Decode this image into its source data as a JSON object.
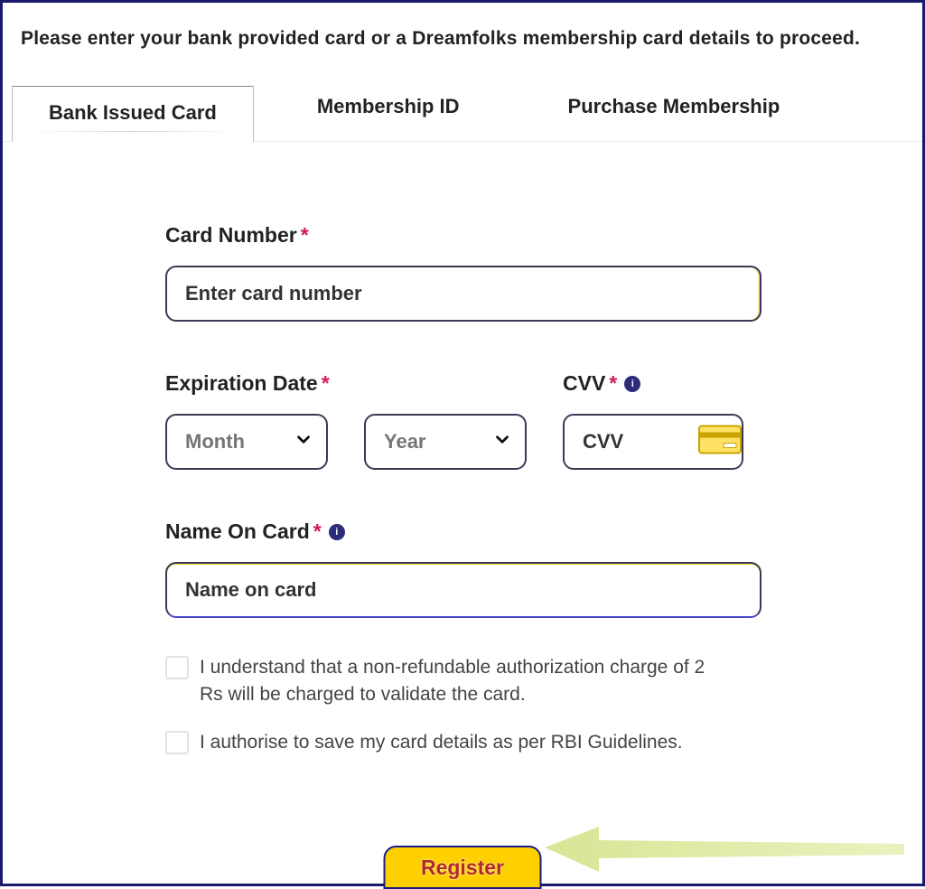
{
  "intro": "Please enter your bank provided card or a Dreamfolks membership card details to proceed.",
  "tabs": {
    "bank": "Bank Issued Card",
    "membership": "Membership ID",
    "purchase": "Purchase Membership"
  },
  "labels": {
    "card_number": "Card Number",
    "exp": "Expiration Date",
    "cvv": "CVV",
    "name": "Name On Card"
  },
  "placeholders": {
    "card_number": "Enter card number",
    "month": "Month",
    "year": "Year",
    "cvv": "CVV",
    "name": "Name on card"
  },
  "checks": {
    "charge": "I understand that a non-refundable authorization charge of 2 Rs will be charged to validate the card.",
    "save": "I authorise to save my card details as per RBI Guidelines."
  },
  "button": "Register",
  "required_mark": "*",
  "info_glyph": "i"
}
